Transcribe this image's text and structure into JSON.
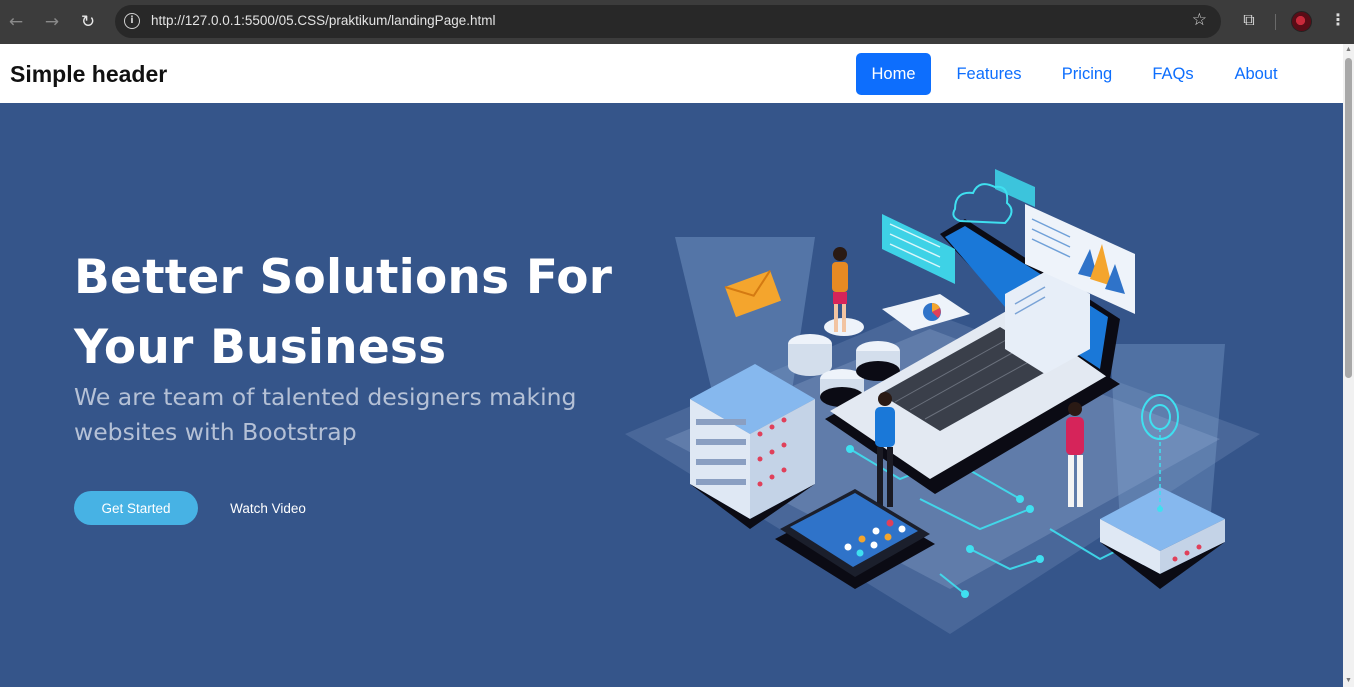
{
  "browser": {
    "url": "http://127.0.0.1:5500/05.CSS/praktikum/landingPage.html",
    "icons": [
      "back-icon",
      "forward-icon",
      "reload-icon",
      "site-info-icon",
      "bookmark-star-icon",
      "extensions-icon",
      "profile-avatar",
      "menu-icon"
    ]
  },
  "header": {
    "brand": "Simple header",
    "nav": [
      {
        "label": "Home",
        "active": true
      },
      {
        "label": "Features",
        "active": false
      },
      {
        "label": "Pricing",
        "active": false
      },
      {
        "label": "FAQs",
        "active": false
      },
      {
        "label": "About",
        "active": false
      }
    ]
  },
  "hero": {
    "title_line1": "Better Solutions For",
    "title_line2": "Your Business",
    "subtitle": "We are team of talented designers making websites with Bootstrap",
    "primary_button": "Get Started",
    "secondary_button": "Watch Video"
  },
  "colors": {
    "hero_bg": "#35558a",
    "accent": "#47b2e4",
    "nav_active": "#0d6efd"
  }
}
